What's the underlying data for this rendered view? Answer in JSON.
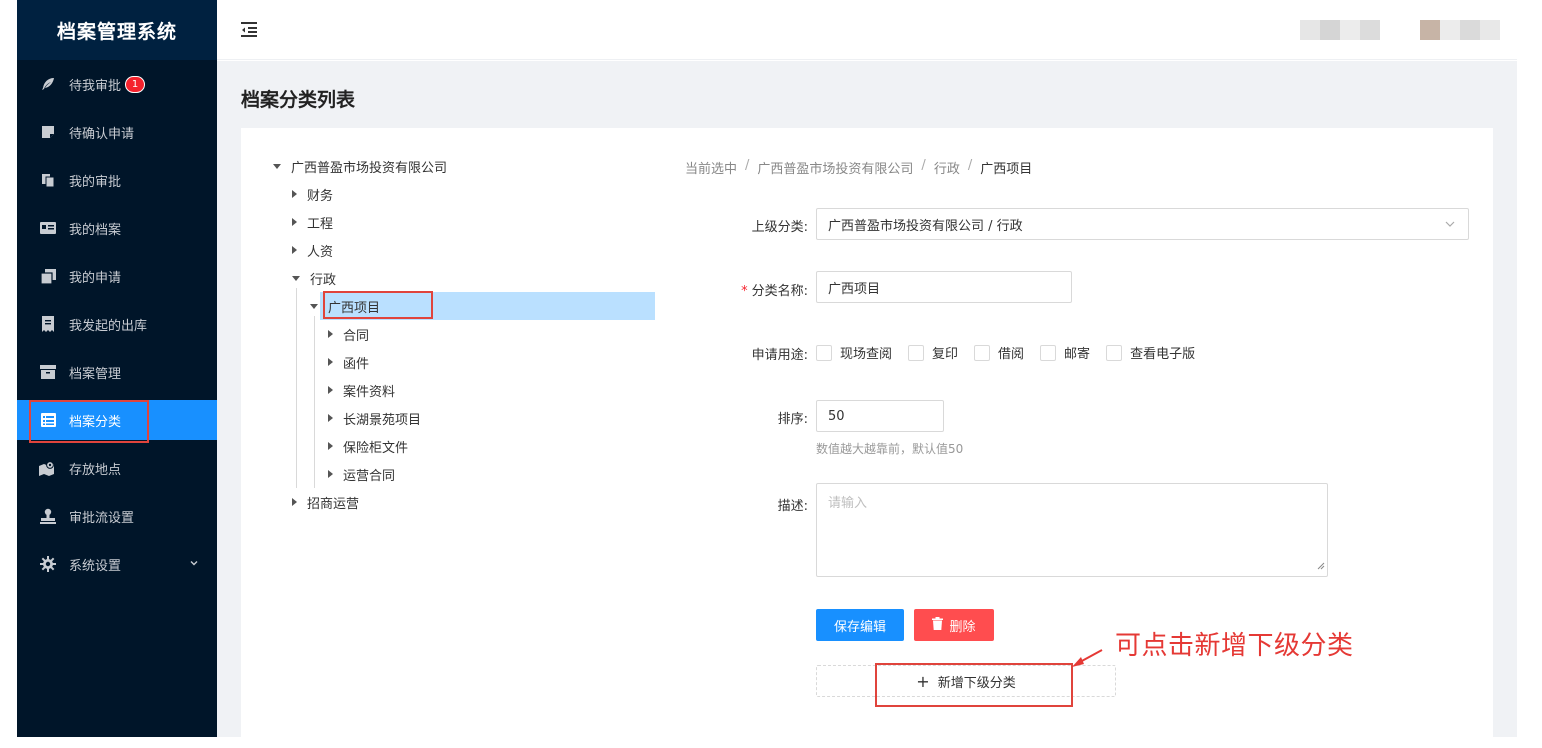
{
  "app": {
    "title": "档案管理系统"
  },
  "sidebar": {
    "items": [
      {
        "label": "待我审批",
        "icon": "feather-icon",
        "badge": "1"
      },
      {
        "label": "待确认申请",
        "icon": "note-icon"
      },
      {
        "label": "我的审批",
        "icon": "copy-icon"
      },
      {
        "label": "我的档案",
        "icon": "id-card-icon"
      },
      {
        "label": "我的申请",
        "icon": "clone-icon"
      },
      {
        "label": "我发起的出库",
        "icon": "receipt-icon"
      },
      {
        "label": "档案管理",
        "icon": "archive-icon"
      },
      {
        "label": "档案分类",
        "icon": "list-icon",
        "active": true
      },
      {
        "label": "存放地点",
        "icon": "map-icon"
      },
      {
        "label": "审批流设置",
        "icon": "stamp-icon"
      },
      {
        "label": "系统设置",
        "icon": "gear-icon"
      }
    ]
  },
  "page": {
    "title": "档案分类列表"
  },
  "tree": {
    "root": "广西普盈市场投资有限公司",
    "level1": [
      "财务",
      "工程",
      "人资",
      "行政",
      "招商运营"
    ],
    "selected": "广西项目",
    "level3": [
      "合同",
      "函件",
      "案件资料",
      "长湖景苑项目",
      "保险柜文件",
      "运营合同"
    ]
  },
  "breadcrumb": {
    "prefix": "当前选中",
    "items": [
      "广西普盈市场投资有限公司",
      "行政",
      "广西项目"
    ],
    "sep": "/"
  },
  "form": {
    "parent_label": "上级分类:",
    "parent_value": "广西普盈市场投资有限公司 / 行政",
    "name_required": "*",
    "name_label": "分类名称:",
    "name_value": "广西项目",
    "usage_label": "申请用途:",
    "usage_options": [
      "现场查阅",
      "复印",
      "借阅",
      "邮寄",
      "查看电子版"
    ],
    "sort_label": "排序:",
    "sort_value": "50",
    "sort_hint": "数值越大越靠前，默认值50",
    "desc_label": "描述:",
    "desc_placeholder": "请输入",
    "save_label": "保存编辑",
    "delete_label": "删除",
    "add_child_label": "新增下级分类"
  },
  "annotation": {
    "text": "可点击新增下级分类"
  },
  "colors": {
    "sidebar": "#001529",
    "accent": "#1890ff",
    "danger": "#ff4d4f",
    "annotation": "#e53935"
  }
}
